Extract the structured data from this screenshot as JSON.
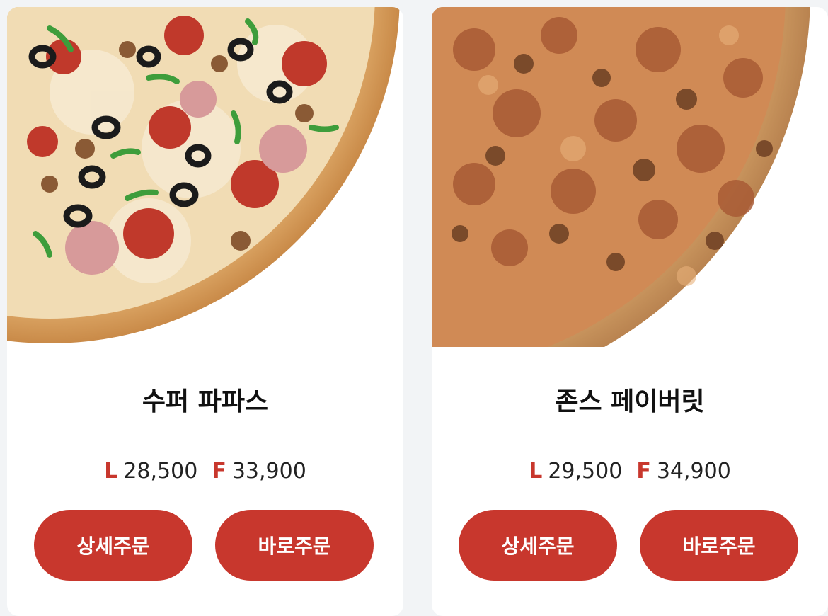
{
  "products": [
    {
      "name": "수퍼 파파스",
      "prices": [
        {
          "size": "L",
          "price": "28,500"
        },
        {
          "size": "F",
          "price": "33,900"
        }
      ],
      "buttons": {
        "detail": "상세주문",
        "quick": "바로주문"
      }
    },
    {
      "name": "존스 페이버릿",
      "prices": [
        {
          "size": "L",
          "price": "29,500"
        },
        {
          "size": "F",
          "price": "34,900"
        }
      ],
      "buttons": {
        "detail": "상세주문",
        "quick": "바로주문"
      }
    }
  ],
  "colors": {
    "accent": "#c8372d",
    "page_background": "#f2f4f6",
    "card_background": "#ffffff"
  }
}
